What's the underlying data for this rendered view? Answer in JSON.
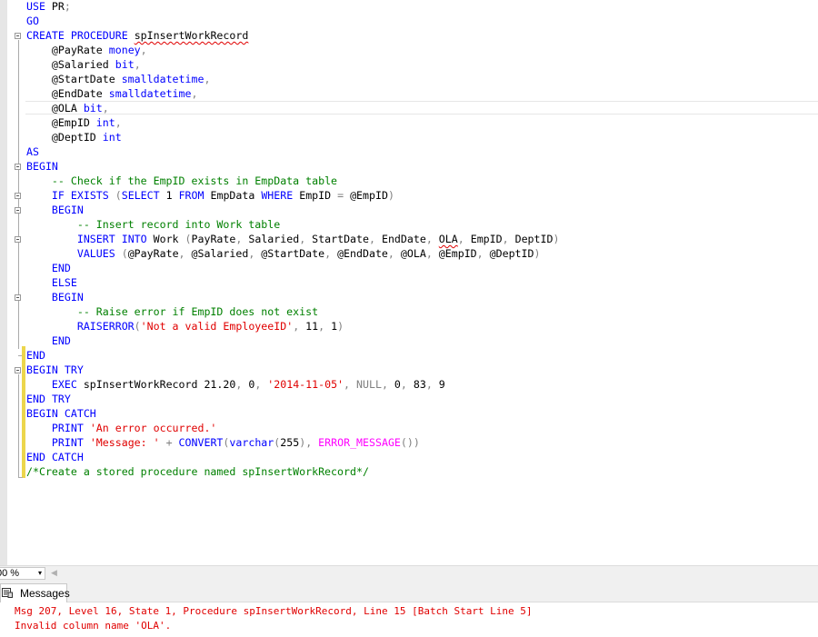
{
  "editor": {
    "lines": [
      "USE PR;",
      "GO",
      "CREATE PROCEDURE spInsertWorkRecord",
      "    @PayRate money,",
      "    @Salaried bit,",
      "    @StartDate smalldatetime,",
      "    @EndDate smalldatetime,",
      "    @OLA bit,",
      "    @EmpID int,",
      "    @DeptID int",
      "AS",
      "BEGIN",
      "    -- Check if the EmpID exists in EmpData table",
      "    IF EXISTS (SELECT 1 FROM EmpData WHERE EmpID = @EmpID)",
      "    BEGIN",
      "        -- Insert record into Work table",
      "        INSERT INTO Work (PayRate, Salaried, StartDate, EndDate, OLA, EmpID, DeptID)",
      "        VALUES (@PayRate, @Salaried, @StartDate, @EndDate, @OLA, @EmpID, @DeptID)",
      "    END",
      "    ELSE",
      "    BEGIN",
      "        -- Raise error if EmpID does not exist",
      "        RAISERROR('Not a valid EmployeeID', 11, 1)",
      "    END",
      "END",
      "BEGIN TRY",
      "    EXEC spInsertWorkRecord 21.20, 0, '2014-11-05', NULL, 0, 83, 9",
      "END TRY",
      "BEGIN CATCH",
      "    PRINT 'An error occurred.'",
      "    PRINT 'Message: ' + CONVERT(varchar(255), ERROR_MESSAGE())",
      "END CATCH",
      "/*Create a stored procedure named spInsertWorkRecord*/"
    ]
  },
  "status": {
    "zoom": "00 %",
    "zoom_arrow": "▾",
    "scroll_left": "◀"
  },
  "results": {
    "tab_label": "Messages",
    "tab_icon": "messages-icon",
    "messages": [
      "Msg 207, Level 16, State 1, Procedure spInsertWorkRecord, Line 15 [Batch Start Line 5]",
      "Invalid column name 'OLA'."
    ]
  },
  "colors": {
    "keyword": "#0000ff",
    "string": "#e00000",
    "comment": "#008000",
    "operator": "#808080",
    "function": "#ff00ff",
    "error": "#e00000",
    "change_bar": "#ecd64c"
  }
}
